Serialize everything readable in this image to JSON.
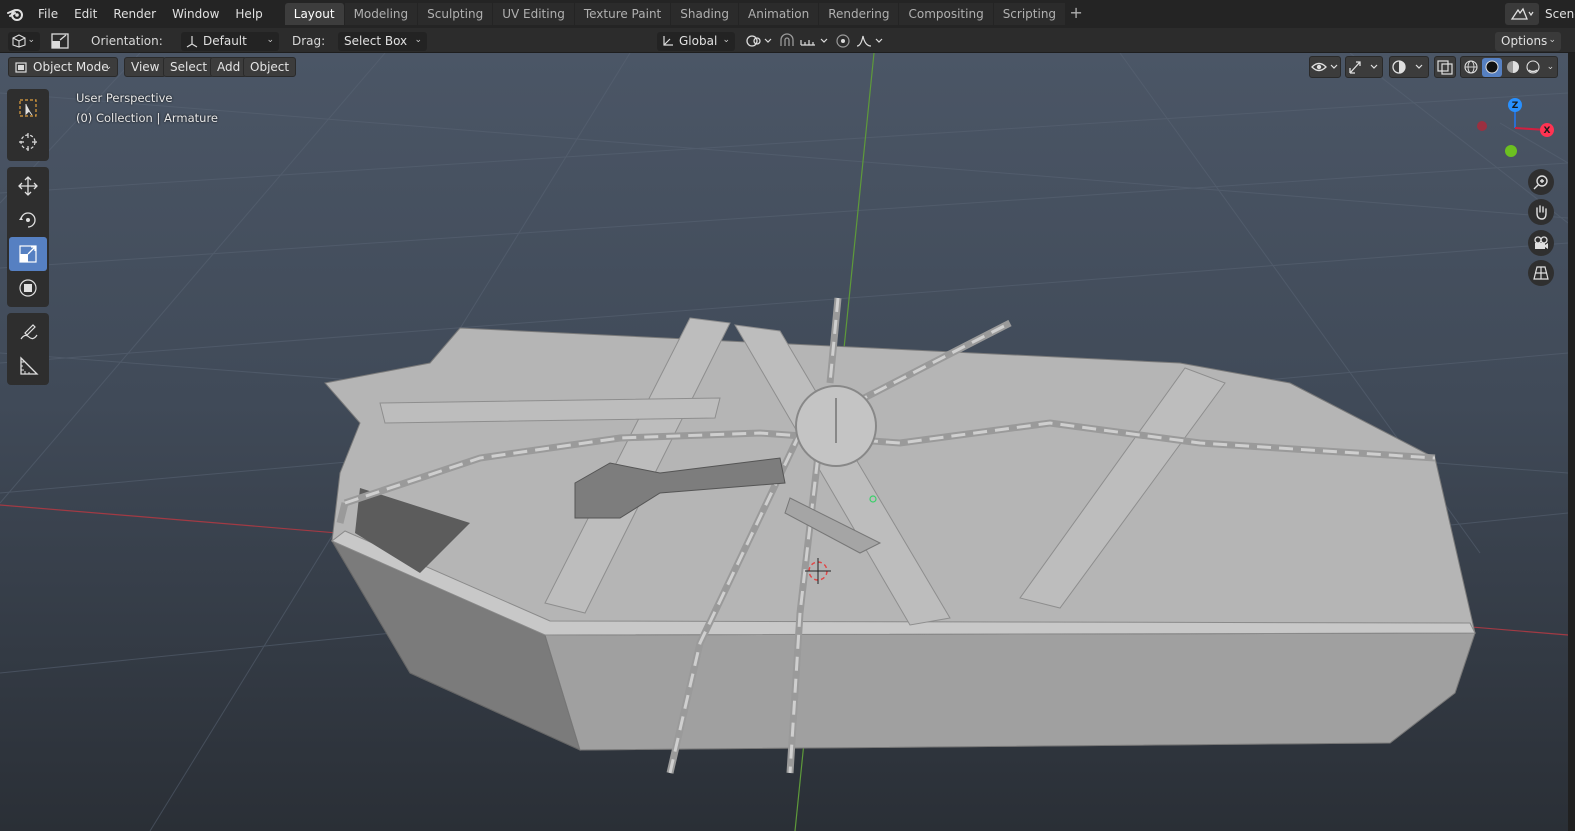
{
  "menubar": {
    "items": [
      "File",
      "Edit",
      "Render",
      "Window",
      "Help"
    ],
    "workspaces": [
      "Layout",
      "Modeling",
      "Sculpting",
      "UV Editing",
      "Texture Paint",
      "Shading",
      "Animation",
      "Rendering",
      "Compositing",
      "Scripting"
    ],
    "active_workspace": "Layout",
    "scene_label": "Scene"
  },
  "toolheader": {
    "orientation_label": "Orientation:",
    "orientation_value": "Default",
    "drag_label": "Drag:",
    "drag_value": "Select Box",
    "transform_orientation": "Global",
    "options_label": "Options"
  },
  "viewport": {
    "mode": "Object Mode",
    "menus": [
      "View",
      "Select",
      "Add",
      "Object"
    ],
    "perspective_label": "User Perspective",
    "collection_label": "(0) Collection | Armature",
    "active_tool": "scale-tool",
    "gizmo_axes": [
      "Z",
      "X"
    ]
  },
  "colors": {
    "accent": "#5680c2",
    "axis_x": "#ff3352",
    "axis_y": "#8bdc00",
    "axis_z": "#2890ff",
    "viewport_top": "#4b5666",
    "viewport_bottom": "#2a2f36"
  }
}
